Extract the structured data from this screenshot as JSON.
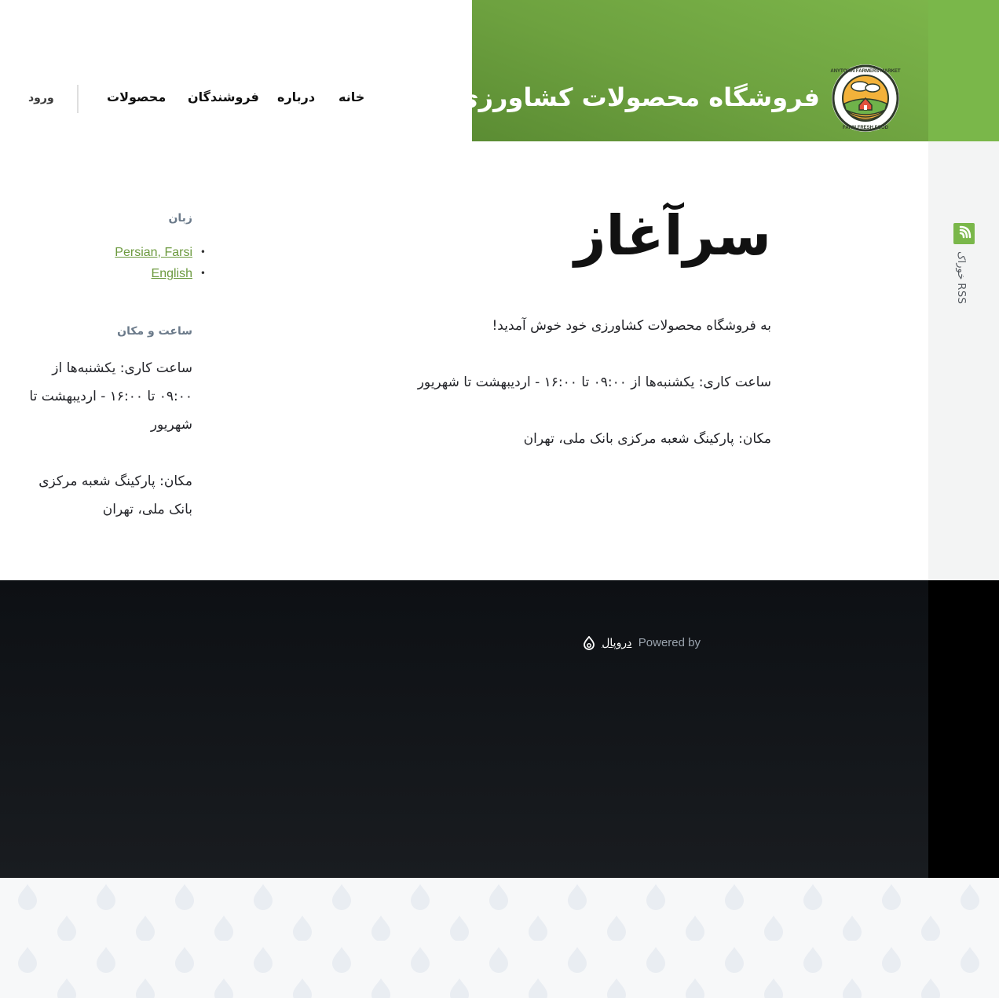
{
  "site": {
    "title": "فروشگاه محصولات کشاورزی",
    "logo_text_top": "ANYTOWN FARMERS MARKET",
    "logo_text_bottom": "FARM FRESH FOOD"
  },
  "nav": {
    "items": [
      {
        "label": "خانه"
      },
      {
        "label": "درباره"
      },
      {
        "label": "فروشندگان"
      },
      {
        "label": "محصولات"
      }
    ],
    "login": "ورود"
  },
  "rss": {
    "label": "خوراک RSS"
  },
  "main": {
    "heading": "سرآغاز",
    "paragraphs": [
      "به فروشگاه محصولات کشاورزی خود خوش آمدید!",
      "ساعت کاری: یکشنبه‌ها از ۰۹:۰۰ تا ۱۶:۰۰ - اردیبهشت تا شهریور",
      "مکان: پارکینگ شعبه مرکزی بانک ملی، تهران"
    ]
  },
  "sidebar": {
    "language_title": "زبان",
    "languages": [
      "Persian, Farsi",
      "English"
    ],
    "hours_title": "ساعت و مکان",
    "hours_text": "ساعت کاری: یکشنبه‌ها از ۰۹:۰۰ تا ۱۶:۰۰ - اردیبهشت تا شهریور",
    "location_text": "مکان: پارکینگ شعبه مرکزی بانک ملی، تهران"
  },
  "footer": {
    "powered_by": "Powered by",
    "drupal": "دروپال"
  },
  "colors": {
    "brand_green": "#7ab74a",
    "link_green": "#6c9a3f",
    "footer_dark": "#121518"
  }
}
